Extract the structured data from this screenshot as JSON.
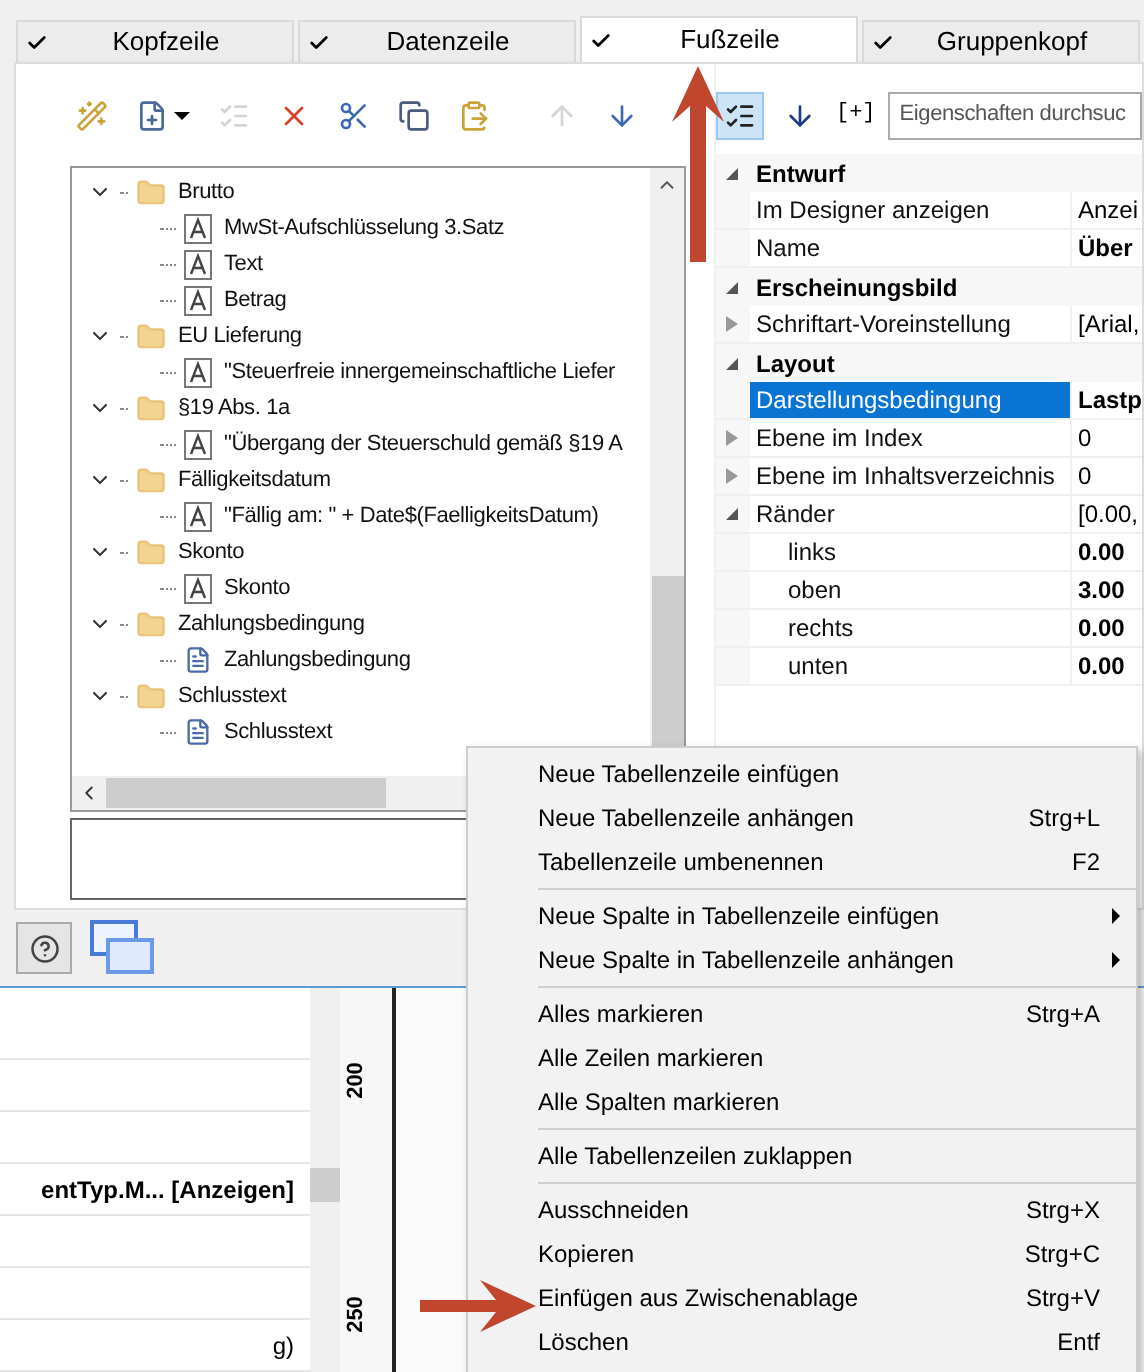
{
  "tabs": [
    {
      "label": "Kopfzeile",
      "checked": true,
      "selected": false
    },
    {
      "label": "Datenzeile",
      "checked": true,
      "selected": false
    },
    {
      "label": "Fußzeile",
      "checked": true,
      "selected": true
    },
    {
      "label": "Gruppenkopf",
      "checked": true,
      "selected": false
    }
  ],
  "toolbar": [
    {
      "kind": "wizard",
      "disabled": false
    },
    {
      "kind": "new",
      "disabled": false
    },
    {
      "kind": "properties",
      "disabled": true
    },
    {
      "kind": "delete",
      "disabled": false
    },
    {
      "kind": "cut",
      "disabled": false
    },
    {
      "kind": "copy",
      "disabled": false
    },
    {
      "kind": "paste",
      "disabled": false
    },
    {
      "kind": "up",
      "disabled": true
    },
    {
      "kind": "down",
      "disabled": false
    }
  ],
  "tree": [
    {
      "label": "Brutto",
      "kind": "folder",
      "expanded": true,
      "children": [
        {
          "label": "MwSt-Aufschlüsselung 3.Satz",
          "kind": "text"
        },
        {
          "label": "Text",
          "kind": "text"
        },
        {
          "label": "Betrag",
          "kind": "text"
        }
      ]
    },
    {
      "label": "EU Lieferung",
      "kind": "folder",
      "expanded": true,
      "children": [
        {
          "label": "\"Steuerfreie innergemeinschaftliche Liefer",
          "kind": "text"
        }
      ]
    },
    {
      "label": "§19 Abs. 1a",
      "kind": "folder",
      "expanded": true,
      "children": [
        {
          "label": "\"Übergang der Steuerschuld gemäß §19 A",
          "kind": "text"
        }
      ]
    },
    {
      "label": "Fälligkeitsdatum",
      "kind": "folder",
      "expanded": true,
      "children": [
        {
          "label": "\"Fällig am: \" + Date$(FaelligkeitsDatum)",
          "kind": "text"
        }
      ]
    },
    {
      "label": "Skonto",
      "kind": "folder",
      "expanded": true,
      "children": [
        {
          "label": "Skonto",
          "kind": "text"
        }
      ]
    },
    {
      "label": "Zahlungsbedingung",
      "kind": "folder",
      "expanded": true,
      "children": [
        {
          "label": "Zahlungsbedingung",
          "kind": "richtext"
        }
      ]
    },
    {
      "label": "Schlusstext",
      "kind": "folder",
      "expanded": true,
      "children": [
        {
          "label": "Schlusstext",
          "kind": "richtext"
        }
      ]
    }
  ],
  "property_toolbar": {
    "views": [
      {
        "kind": "categorized",
        "selected": true
      },
      {
        "kind": "alphabetical",
        "selected": false
      }
    ],
    "expand_all": "[+]",
    "search": {
      "placeholder": "Eigenschaften durchsuc"
    }
  },
  "property_grid": [
    {
      "category": "Entwurf",
      "expanded": true,
      "rows": [
        {
          "name": "Im Designer anzeigen",
          "value": "Anzei",
          "bold": false,
          "selected": false
        },
        {
          "name": "Name",
          "value": "Über",
          "bold": true,
          "selected": false
        }
      ]
    },
    {
      "category": "Erscheinungsbild",
      "expanded": true,
      "rows": [
        {
          "name": "Schriftart-Voreinstellung",
          "value": "[Arial,",
          "bold": false,
          "selected": false,
          "expanded": false
        }
      ]
    },
    {
      "category": "Layout",
      "expanded": true,
      "rows": [
        {
          "name": "Darstellungsbedingung",
          "value": "Lastp",
          "bold": true,
          "selected": true
        },
        {
          "name": "Ebene im Index",
          "value": "0",
          "bold": false,
          "selected": false,
          "expanded": false
        },
        {
          "name": "Ebene im Inhaltsverzeichnis",
          "value": "0",
          "bold": false,
          "selected": false,
          "expanded": false
        },
        {
          "name": "Ränder",
          "value": "[0.00,",
          "bold": false,
          "selected": false,
          "expanded": true,
          "children": [
            {
              "name": "links",
              "value": "0.00",
              "bold": true,
              "selected": false
            },
            {
              "name": "oben",
              "value": "3.00",
              "bold": true,
              "selected": false
            },
            {
              "name": "rechts",
              "value": "0.00",
              "bold": true,
              "selected": false
            },
            {
              "name": "unten",
              "value": "0.00",
              "bold": true,
              "selected": false
            }
          ]
        }
      ]
    }
  ],
  "designer": {
    "rows": [
      "",
      "",
      "",
      "entTyp.M... [Anzeigen]",
      "",
      "",
      "g)"
    ],
    "ruler_labels": [
      "200",
      "250"
    ]
  },
  "context_menu": [
    [
      {
        "label": "Neue Tabellenzeile einfügen"
      },
      {
        "label": "Neue Tabellenzeile anhängen",
        "shortcut": "Strg+L"
      },
      {
        "label": "Tabellenzeile umbenennen",
        "shortcut": "F2"
      }
    ],
    [
      {
        "label": "Neue Spalte in Tabellenzeile einfügen",
        "submenu": true
      },
      {
        "label": "Neue Spalte in Tabellenzeile anhängen",
        "submenu": true
      }
    ],
    [
      {
        "label": "Alles markieren",
        "shortcut": "Strg+A"
      },
      {
        "label": "Alle Zeilen markieren"
      },
      {
        "label": "Alle Spalten markieren"
      }
    ],
    [
      {
        "label": "Alle Tabellenzeilen zuklappen"
      }
    ],
    [
      {
        "label": "Ausschneiden",
        "shortcut": "Strg+X"
      },
      {
        "label": "Kopieren",
        "shortcut": "Strg+C"
      },
      {
        "label": "Einfügen aus Zwischenablage",
        "shortcut": "Strg+V"
      },
      {
        "label": "Löschen",
        "shortcut": "Entf"
      }
    ]
  ]
}
